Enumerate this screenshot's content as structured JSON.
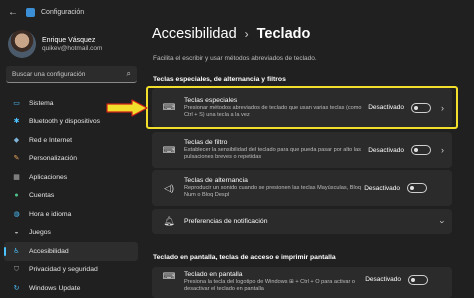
{
  "window": {
    "title": "Configuración"
  },
  "profile": {
    "name": "Enrique Vásquez",
    "email": "quikev@hotmail.com"
  },
  "search": {
    "placeholder": "Buscar una configuración"
  },
  "sidebar": {
    "items": [
      {
        "label": "Sistema",
        "icon": "monitor-icon",
        "color": "#4cc2ff"
      },
      {
        "label": "Bluetooth y dispositivos",
        "icon": "bluetooth-icon",
        "color": "#4cc2ff"
      },
      {
        "label": "Red e Internet",
        "icon": "network-icon",
        "color": "#7fb3d8"
      },
      {
        "label": "Personalización",
        "icon": "brush-icon",
        "color": "#e8a55a"
      },
      {
        "label": "Aplicaciones",
        "icon": "apps-icon",
        "color": "#b0b0b0"
      },
      {
        "label": "Cuentas",
        "icon": "person-icon",
        "color": "#4fc28a"
      },
      {
        "label": "Hora e idioma",
        "icon": "globe-icon",
        "color": "#4cc2ff"
      },
      {
        "label": "Juegos",
        "icon": "controller-icon",
        "color": "#b0b0b0"
      },
      {
        "label": "Accesibilidad",
        "icon": "accessibility-icon",
        "color": "#4cc2ff",
        "active": true
      },
      {
        "label": "Privacidad y seguridad",
        "icon": "shield-icon",
        "color": "#9a9a9a"
      },
      {
        "label": "Windows Update",
        "icon": "update-icon",
        "color": "#4cc2ff"
      }
    ]
  },
  "main": {
    "breadcrumb_parent": "Accesibilidad",
    "breadcrumb_sep": "›",
    "breadcrumb_current": "Teclado",
    "description": "Facilita el escribir y usar métodos abreviados de teclado.",
    "section1_title": "Teclas especiales, de alternancia y filtros",
    "section2_title": "Teclado en pantalla, teclas de acceso e imprimir pantalla",
    "cards": [
      {
        "title": "Teclas especiales",
        "subtitle": "Presionar métodos abreviados de teclado que usan varias teclas (como Ctrl + S) una tecla a la vez",
        "status": "Desactivado",
        "icon": "keyboard-icon"
      },
      {
        "title": "Teclas de filtro",
        "subtitle": "Establecer la sensibilidad del teclado para que pueda pasar por alto las pulsaciones breves o repetidas",
        "status": "Desactivado",
        "icon": "keyboard-icon"
      },
      {
        "title": "Teclas de alternancia",
        "subtitle": "Reproducir un sonido cuando se presionen las teclas Mayúsculas, Bloq Num o Bloq Despl",
        "status": "Desactivado",
        "icon": "speaker-icon"
      },
      {
        "title": "Preferencias de notificación",
        "icon": "bell-icon"
      },
      {
        "title": "Teclado en pantalla",
        "subtitle": "Presiona la tecla del logotipo de Windows ⊞ + Ctrl + O para activar o desactivar el teclado en pantalla",
        "status": "Desactivado",
        "icon": "keyboard-icon"
      }
    ]
  },
  "annotation": {
    "highlight_color": "#f1df2c",
    "arrow_color": "#f1df2c",
    "arrow_outline": "#d0201a"
  }
}
